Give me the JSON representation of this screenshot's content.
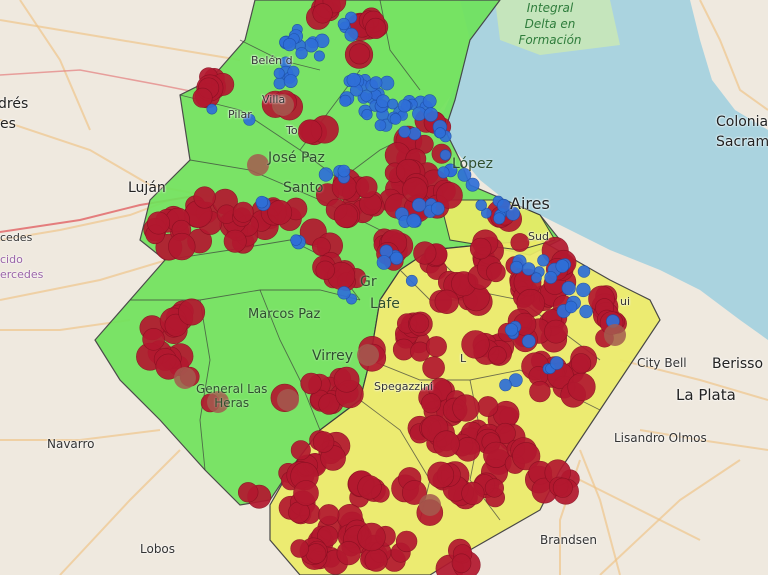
{
  "map": {
    "colors": {
      "land": "#efe9df",
      "water": "#aad3df",
      "delta": "#c8e7b8",
      "zone_green": "#6ee35a",
      "zone_yellow": "#ecec68",
      "boundary": "#3a3a3a",
      "marker_red": "#b3182f",
      "marker_blue": "#2f6fd8",
      "road": "#f0c48a",
      "highway": "#e47d7d"
    },
    "labels": {
      "water_title": [
        "Integral",
        "Delta en",
        "Formación"
      ],
      "lujan": "Luján",
      "andres": "drés",
      "es": "es",
      "cedes": "cedes",
      "cido": "cido",
      "ercedes": "ercedes",
      "colonia": "Colonia",
      "sacram": "Sacram",
      "belen": "Belén d",
      "pilar": "Pilar",
      "villa": "Villa",
      "jose_paz": "José Paz",
      "lopez": "López",
      "santos": "Santo",
      "aires": "Aires",
      "lafe": "Lafe",
      "marcos_paz": "Marcos Paz",
      "virrey": "Virrey",
      "general_las_heras": [
        "General Las",
        "Heras"
      ],
      "spegazzini": "Spegazzini",
      "city_bell": "City Bell",
      "berisso": "Berisso",
      "la_plata": "La Plata",
      "lisandro_olmos": "Lisandro Olmos",
      "navarro": "Navarro",
      "lobos": "Lobos",
      "brandsen": "Brandsen",
      "to": "To",
      "gr": "Gr",
      "ui": "ui",
      "sud": "Sud",
      "l": "L"
    }
  }
}
